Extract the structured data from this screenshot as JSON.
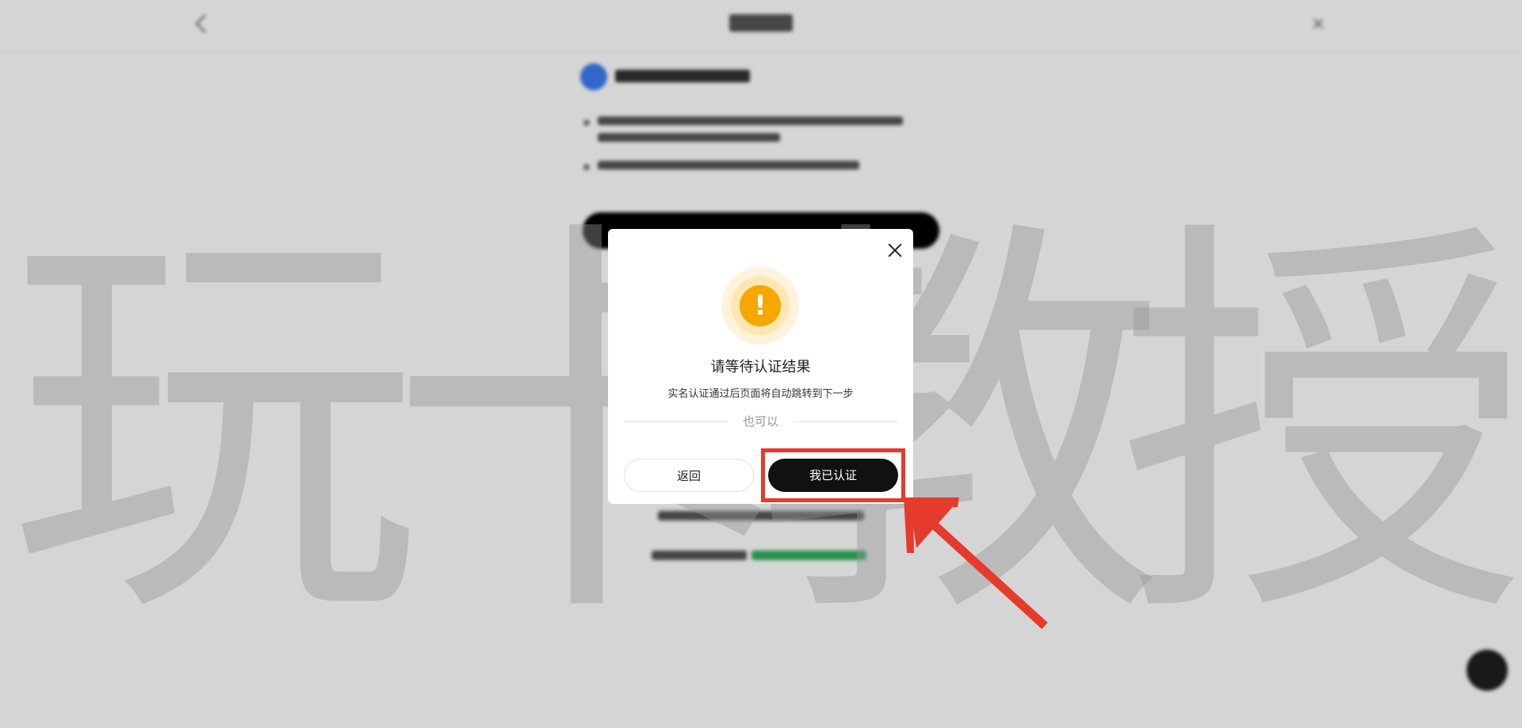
{
  "dialog": {
    "title": "请等待认证结果",
    "subtitle": "实名认证通过后页面将自动跳转到下一步",
    "divider_text": "也可以",
    "back_label": "返回",
    "confirm_label": "我已认证",
    "warning_symbol": "!"
  },
  "watermark": {
    "chars": [
      "玩",
      "卡",
      "教",
      "授"
    ]
  },
  "background": {
    "close_symbol": "×"
  },
  "icons": {
    "close": "close-icon",
    "warning": "warning-icon",
    "back": "back-arrow-icon"
  },
  "colors": {
    "accent_warning": "#f5a700",
    "primary_button": "#111111",
    "highlight": "#e53b2c",
    "step_blue": "#3d7cf2"
  }
}
